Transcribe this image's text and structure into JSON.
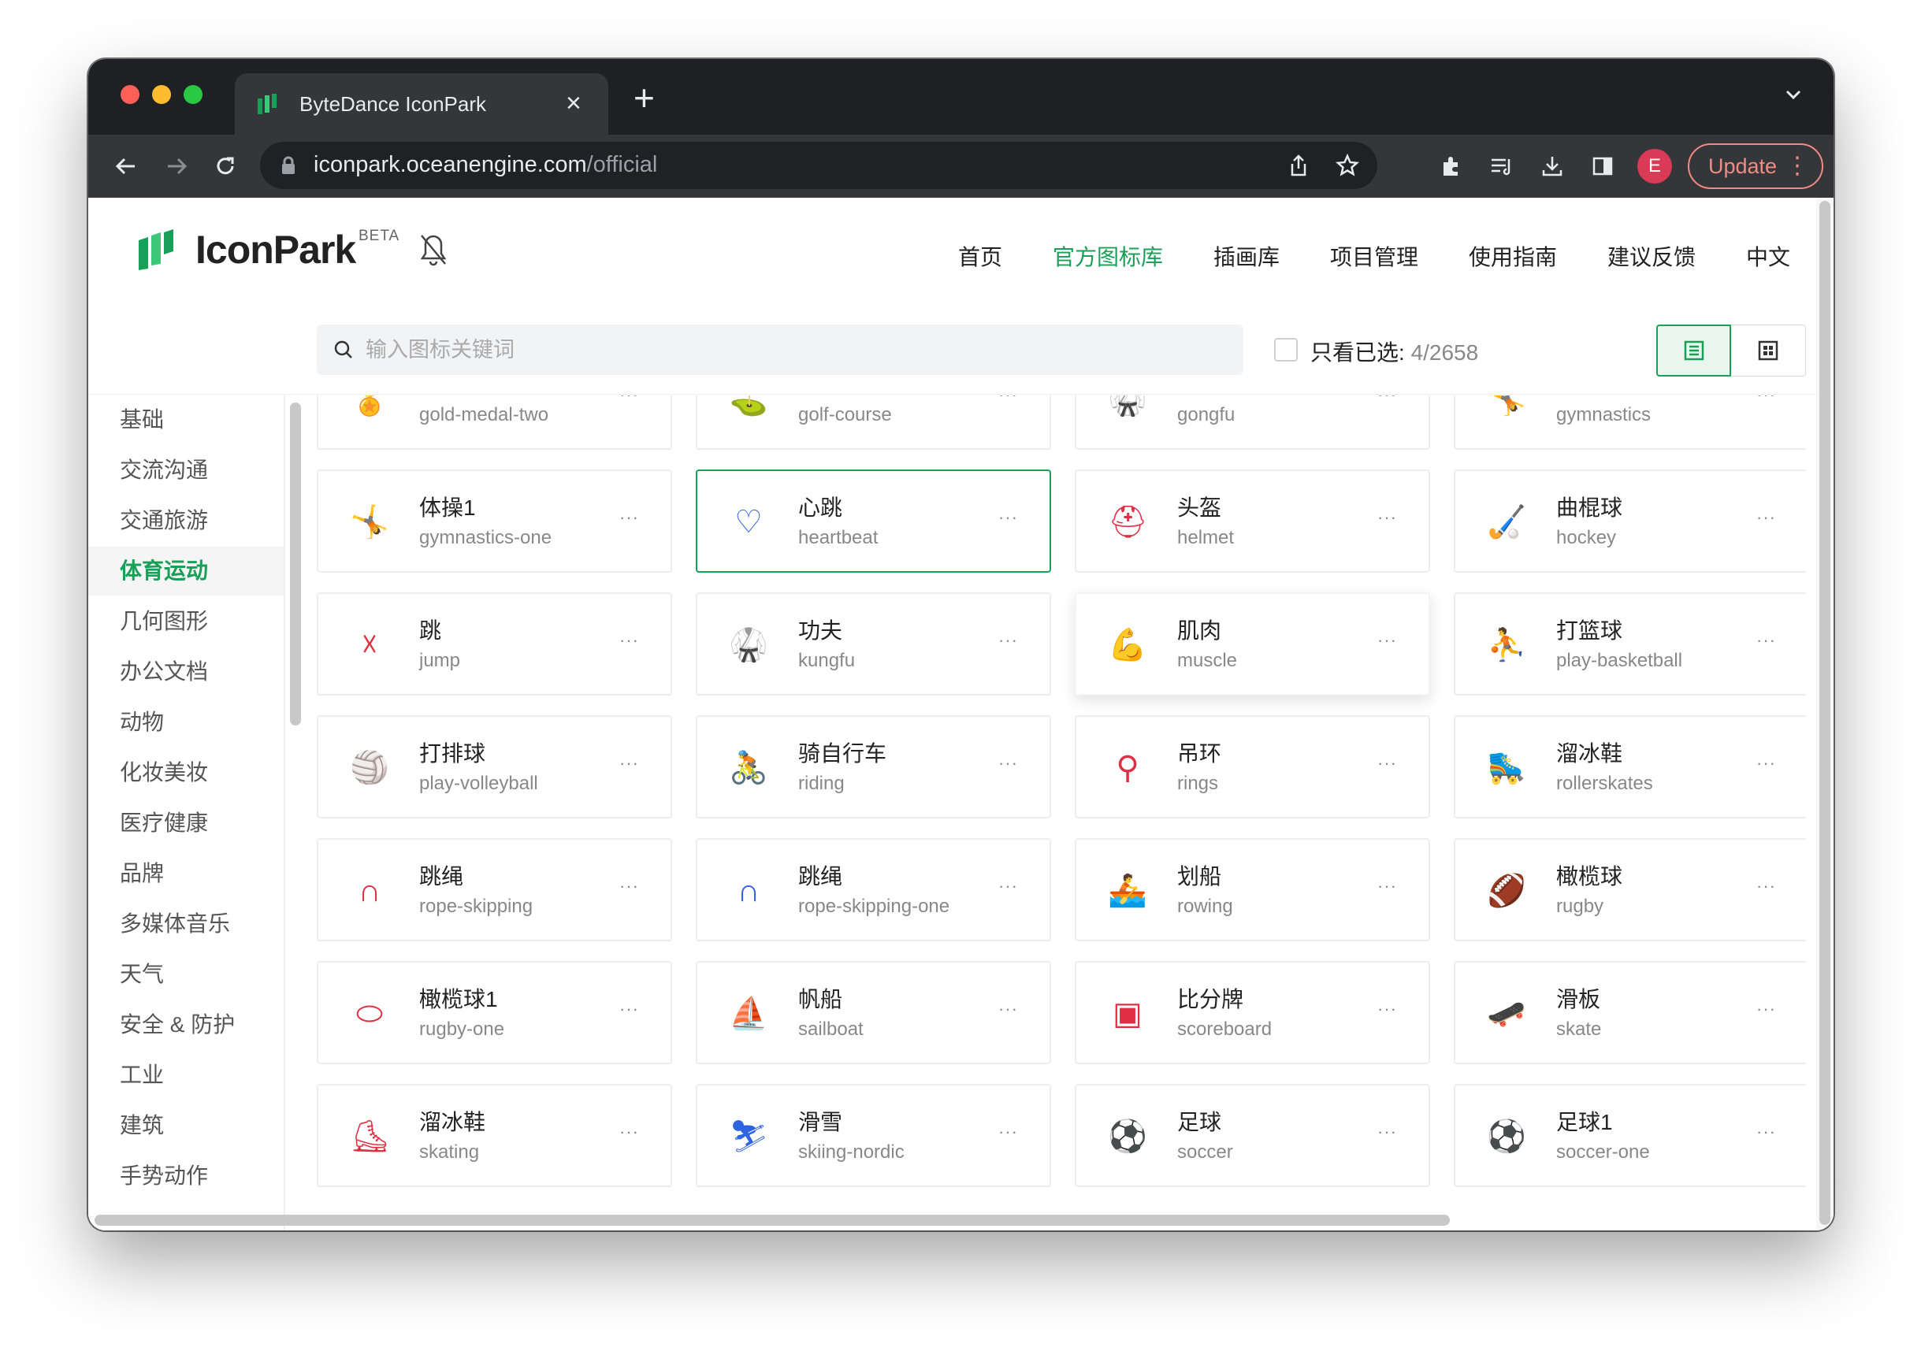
{
  "browser": {
    "tab_title": "ByteDance IconPark",
    "url_host": "iconpark.oceanengine.com",
    "url_path": "/official",
    "avatar_letter": "E",
    "update_label": "Update"
  },
  "header": {
    "logo_text": "IconPark",
    "logo_badge": "BETA",
    "nav": [
      "首页",
      "官方图标库",
      "插画库",
      "项目管理",
      "使用指南",
      "建议反馈",
      "中文"
    ],
    "active_nav": "官方图标库"
  },
  "search": {
    "placeholder": "输入图标关键词",
    "only_selected_label": "只看已选:",
    "selected_count": "4/2658"
  },
  "sidebar": {
    "categories": [
      "基础",
      "交流沟通",
      "交通旅游",
      "体育运动",
      "几何图形",
      "办公文档",
      "动物",
      "化妆美妆",
      "医疗健康",
      "品牌",
      "多媒体音乐",
      "天气",
      "安全 & 防护",
      "工业",
      "建筑",
      "手势动作"
    ],
    "active": "体育运动"
  },
  "icons": [
    {
      "cn": "",
      "en": "gold-medal-two",
      "glyph": "🏅",
      "icon": "gold-medal-two-icon"
    },
    {
      "cn": "",
      "en": "golf-course",
      "glyph": "⛳",
      "icon": "golf-course-icon"
    },
    {
      "cn": "",
      "en": "gongfu",
      "glyph": "🥋",
      "icon": "gongfu-icon"
    },
    {
      "cn": "",
      "en": "gymnastics",
      "glyph": "🤸",
      "icon": "gymnastics-icon"
    },
    {
      "cn": "体操1",
      "en": "gymnastics-one",
      "glyph": "🤸",
      "icon": "gymnastics-one-icon"
    },
    {
      "cn": "心跳",
      "en": "heartbeat",
      "glyph": "♡",
      "icon": "heartbeat-icon"
    },
    {
      "cn": "头盔",
      "en": "helmet",
      "glyph": "⛑",
      "icon": "helmet-icon"
    },
    {
      "cn": "曲棍球",
      "en": "hockey",
      "glyph": "🏑",
      "icon": "hockey-icon"
    },
    {
      "cn": "跳",
      "en": "jump",
      "glyph": "☓",
      "icon": "jump-icon"
    },
    {
      "cn": "功夫",
      "en": "kungfu",
      "glyph": "🥋",
      "icon": "kungfu-icon"
    },
    {
      "cn": "肌肉",
      "en": "muscle",
      "glyph": "💪",
      "icon": "muscle-icon"
    },
    {
      "cn": "打篮球",
      "en": "play-basketball",
      "glyph": "⛹",
      "icon": "play-basketball-icon"
    },
    {
      "cn": "打排球",
      "en": "play-volleyball",
      "glyph": "🏐",
      "icon": "play-volleyball-icon"
    },
    {
      "cn": "骑自行车",
      "en": "riding",
      "glyph": "🚴",
      "icon": "riding-icon"
    },
    {
      "cn": "吊环",
      "en": "rings",
      "glyph": "⚲",
      "icon": "rings-icon"
    },
    {
      "cn": "溜冰鞋",
      "en": "rollerskates",
      "glyph": "🛼",
      "icon": "rollerskates-icon"
    },
    {
      "cn": "跳绳",
      "en": "rope-skipping",
      "glyph": "∩",
      "icon": "rope-skipping-icon"
    },
    {
      "cn": "跳绳",
      "en": "rope-skipping-one",
      "glyph": "∩",
      "icon": "rope-skipping-one-icon"
    },
    {
      "cn": "划船",
      "en": "rowing",
      "glyph": "🚣",
      "icon": "rowing-icon"
    },
    {
      "cn": "橄榄球",
      "en": "rugby",
      "glyph": "🏈",
      "icon": "rugby-icon"
    },
    {
      "cn": "橄榄球1",
      "en": "rugby-one",
      "glyph": "⬭",
      "icon": "rugby-one-icon"
    },
    {
      "cn": "帆船",
      "en": "sailboat",
      "glyph": "⛵",
      "icon": "sailboat-icon"
    },
    {
      "cn": "比分牌",
      "en": "scoreboard",
      "glyph": "▣",
      "icon": "scoreboard-icon"
    },
    {
      "cn": "滑板",
      "en": "skate",
      "glyph": "🛹",
      "icon": "skate-icon"
    },
    {
      "cn": "溜冰鞋",
      "en": "skating",
      "glyph": "⛸",
      "icon": "skating-icon"
    },
    {
      "cn": "滑雪",
      "en": "skiing-nordic",
      "glyph": "⛷",
      "icon": "skiing-nordic-icon"
    },
    {
      "cn": "足球",
      "en": "soccer",
      "glyph": "⚽",
      "icon": "soccer-icon"
    },
    {
      "cn": "足球1",
      "en": "soccer-one",
      "glyph": "⚽",
      "icon": "soccer-one-icon"
    }
  ],
  "card_more_label": "···",
  "selected_icon": "heartbeat",
  "hovered_icon": "muscle",
  "colors": {
    "accent": "#18a058",
    "icon_red": "#e02f44",
    "icon_blue": "#2f64e0"
  }
}
